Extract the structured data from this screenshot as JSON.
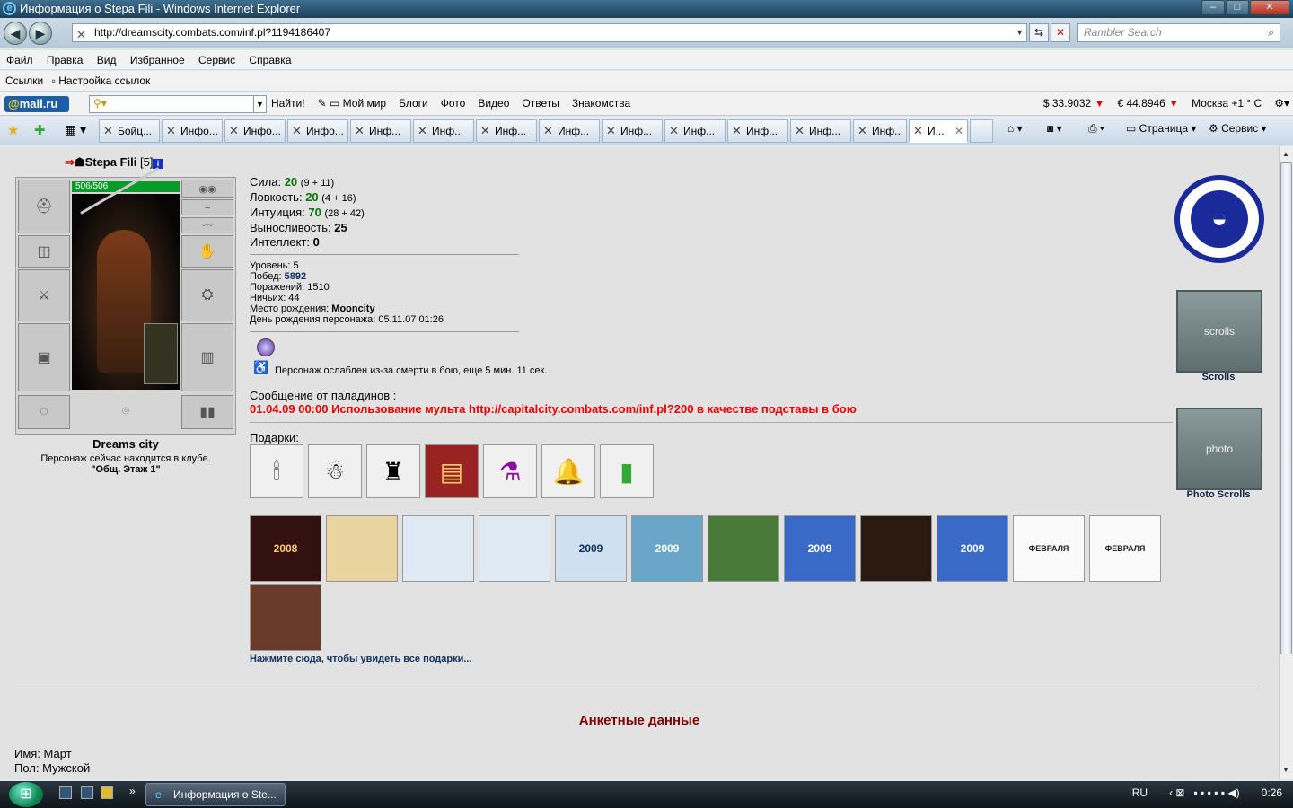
{
  "window": {
    "title": "Информация о Stepa Fili - Windows Internet Explorer"
  },
  "address": {
    "url": "http://dreamscity.combats.com/inf.pl?1194186407"
  },
  "search": {
    "placeholder": "Rambler Search"
  },
  "menu": [
    "Файл",
    "Правка",
    "Вид",
    "Избранное",
    "Сервис",
    "Справка"
  ],
  "links": {
    "label": "Ссылки",
    "item": "Настройка ссылок"
  },
  "mailbar": {
    "logo": "mail.ru",
    "find": "Найти!",
    "items": [
      "Мой мир",
      "Блоги",
      "Фото",
      "Видео",
      "Ответы",
      "Знакомства"
    ],
    "usd": "$ 33.9032",
    "eur": "€ 44.8946",
    "weather": "Москва +1 ° С"
  },
  "tabs": [
    "Бойц...",
    "Инфо...",
    "Инфо...",
    "Инфо...",
    "Инф...",
    "Инф...",
    "Инф...",
    "Инф...",
    "Инф...",
    "Инф...",
    "Инф...",
    "Инф...",
    "Инф...",
    "И..."
  ],
  "toolbar": {
    "page": "Страница",
    "service": "Сервис"
  },
  "character": {
    "nick": "Stepa Fili",
    "level": "[5]",
    "hp": "506/506",
    "club": "Dreams city",
    "location_text": "Персонаж сейчас находится в клубе.",
    "location": "\"Общ. Этаж 1\""
  },
  "stats": [
    {
      "label": "Сила:",
      "value": "20",
      "extra": "(9 + 11)"
    },
    {
      "label": "Ловкость:",
      "value": "20",
      "extra": "(4 + 16)"
    },
    {
      "label": "Интуиция:",
      "value": "70",
      "extra": "(28 + 42)"
    },
    {
      "label": "Выносливость:",
      "value": "25",
      "extra": ""
    },
    {
      "label": "Интеллект:",
      "value": "0",
      "extra": ""
    }
  ],
  "info": {
    "level": "Уровень: 5",
    "wins_label": "Побед:",
    "wins": "5892",
    "losses": "Поражений: 1510",
    "draws": "Ничьих: 44",
    "birthplace_label": "Место рождения:",
    "birthplace": "Mooncity",
    "birthday": "День рождения персонажа: 05.11.07 01:26"
  },
  "weakness": "Персонаж ослаблен из-за смерти в бою, еще 5 мин. 11 сек.",
  "paladins": {
    "heading": "Сообщение от паладинов :",
    "message": "01.04.09 00:00 Использование мульта http://capitalcity.combats.com/inf.pl?200 в качестве подставы в бою"
  },
  "gifts": {
    "label": "Подарки:",
    "items": [
      "candle",
      "teddy-bear",
      "tower",
      "book",
      "potions",
      "bell",
      "bottle"
    ],
    "card_texts": [
      "2008",
      "",
      "",
      "",
      "2009",
      "2009",
      "",
      "2009",
      "",
      "2009",
      "ФЕВРАЛЯ",
      "ФЕВРАЛЯ",
      ""
    ],
    "more": "Нажмите сюда, чтобы увидеть все подарки..."
  },
  "anketa": {
    "heading": "Анкетные данные",
    "name": "Имя: Март",
    "sex": "Пол: Мужской"
  },
  "sidebar": {
    "scrolls": "Scrolls",
    "photo_scrolls": "Photo Scrolls",
    "banner1": "scrolls",
    "banner2": "photo"
  },
  "taskbar": {
    "window": "Информация о Ste...",
    "lang": "RU",
    "time": "0:26"
  }
}
